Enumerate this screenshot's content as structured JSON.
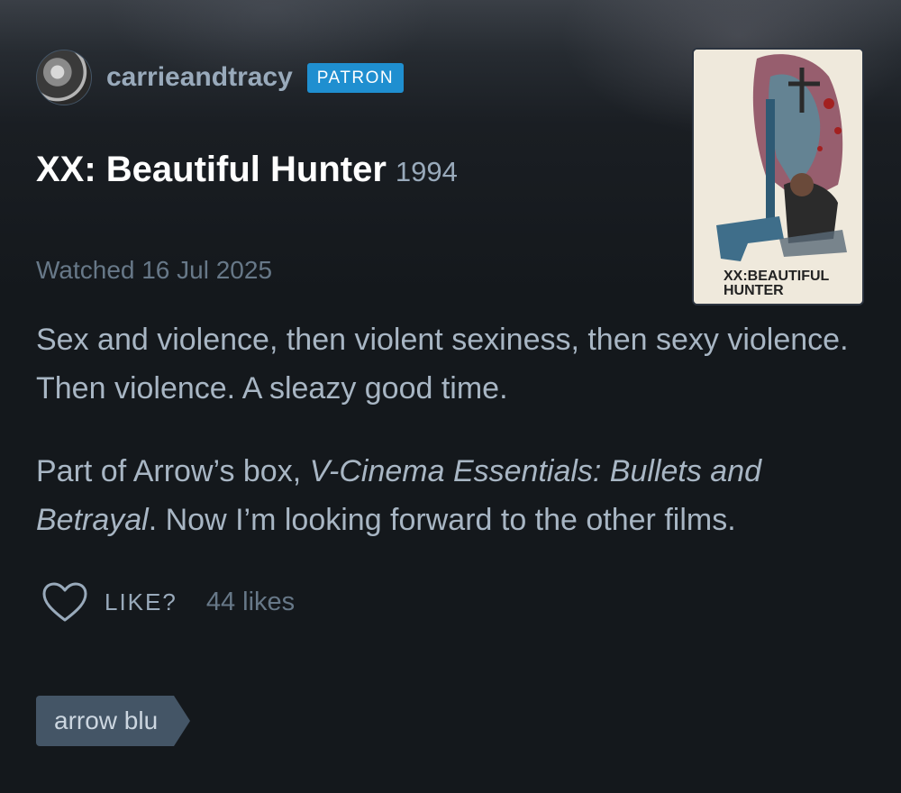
{
  "author": {
    "username": "carrieandtracy",
    "badge": "PATRON",
    "avatar_icon": "user-avatar"
  },
  "film": {
    "title": "XX: Beautiful Hunter",
    "year": "1994",
    "watched": "Watched 16 Jul 2025",
    "poster_text": "XX:BEAUTIFUL HUNTER"
  },
  "review": {
    "paragraph1": "Sex and violence, then violent sexiness, then sexy violence.  Then violence.  A sleazy good time.",
    "p2_before": "Part of Arrow’s box, ",
    "p2_italic1": "V-Cinema Essentials:  Bullets and Betrayal",
    "p2_after": ".  Now I’m looking forward to the other films."
  },
  "like": {
    "icon": "heart-icon",
    "label": "LIKE?",
    "count": "44 likes"
  },
  "tags": [
    {
      "label": "arrow blu"
    }
  ],
  "colors": {
    "background": "#14181c",
    "badge": "#1f8fd0",
    "username": "#99aabb",
    "body_text": "#a8b6c4",
    "muted": "#677888",
    "tag": "#445566"
  }
}
